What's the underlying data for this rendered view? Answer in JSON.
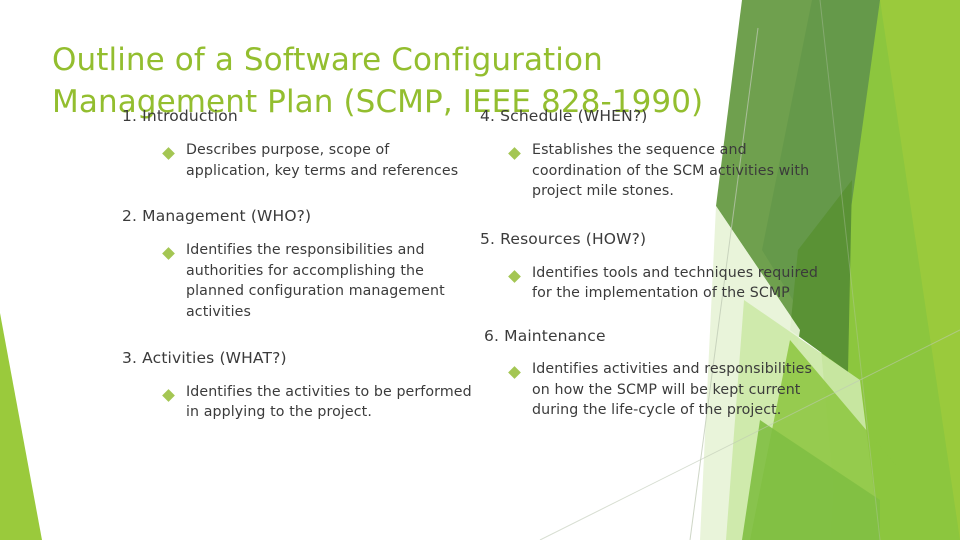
{
  "slide": {
    "title_lines": [
      "Outline of a Software Configuration",
      "Management Plan (SCMP, IEEE 828-1990)"
    ],
    "title_color": "#93BE2F",
    "body_color": "#3b3b3b",
    "bullet_color": "#A4C653",
    "background_color": "#ffffff"
  },
  "theme_colors": {
    "accent_bright_green": "#9ACA3C",
    "accent_mid_green": "#8CC63E",
    "accent_dark_green": "#6FA04E",
    "accent_deep_green": "#5A9235",
    "accent_light_tint": "#CCE8A8",
    "accent_pale_tint": "#E2F0CE",
    "hairline": "#BEC9B4"
  },
  "left_column": {
    "sections": [
      {
        "heading": "1. Introduction",
        "bullets": [
          "Describes purpose, scope of application, key terms and references"
        ]
      },
      {
        "heading": "2. Management (WHO?)",
        "bullets": [
          "Identifies the responsibilities and authorities for accomplishing the planned configuration management activities"
        ]
      },
      {
        "heading": "3. Activities (WHAT?)",
        "bullets": [
          "Identifies the activities to be performed in applying to the project."
        ]
      }
    ]
  },
  "right_column": {
    "sections": [
      {
        "heading": "4. Schedule (WHEN?)",
        "bullets": [
          "Establishes the sequence and coordination of the SCM activities with project mile stones."
        ]
      },
      {
        "heading": "5. Resources (HOW?)",
        "bullets": [
          "Identifies tools and techniques required for the implementation of the SCMP"
        ]
      },
      {
        "heading": "6. Maintenance",
        "bullets": [
          "Identifies activities and responsibilities on how the SCMP will be kept current during the life-cycle of the project."
        ]
      }
    ]
  }
}
